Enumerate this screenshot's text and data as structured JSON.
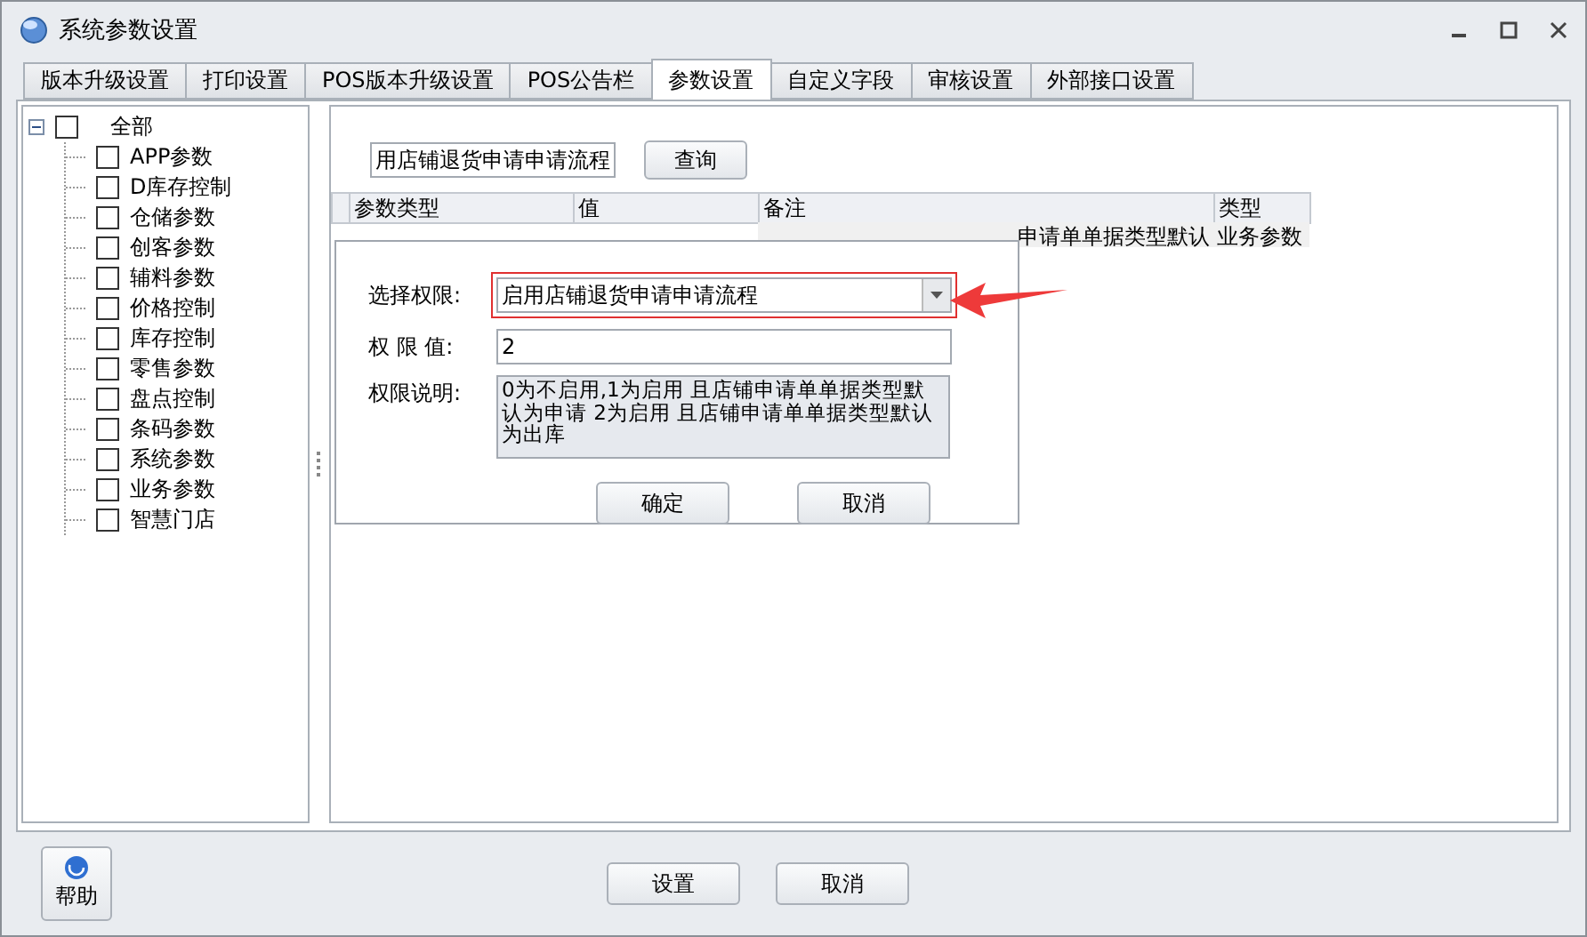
{
  "window": {
    "title": "系统参数设置"
  },
  "tabs": [
    {
      "label": "版本升级设置",
      "selected": false
    },
    {
      "label": "打印设置",
      "selected": false
    },
    {
      "label": "POS版本升级设置",
      "selected": false
    },
    {
      "label": "POS公告栏",
      "selected": false
    },
    {
      "label": "参数设置",
      "selected": true
    },
    {
      "label": "自定义字段",
      "selected": false
    },
    {
      "label": "审核设置",
      "selected": false
    },
    {
      "label": "外部接口设置",
      "selected": false
    }
  ],
  "tree": {
    "label": "全部",
    "checked": false,
    "expanded": true,
    "children": [
      {
        "label": "APP参数",
        "checked": false
      },
      {
        "label": "D库存控制",
        "checked": false
      },
      {
        "label": "仓储参数",
        "checked": false
      },
      {
        "label": "创客参数",
        "checked": false
      },
      {
        "label": "辅料参数",
        "checked": false
      },
      {
        "label": "价格控制",
        "checked": false
      },
      {
        "label": "库存控制",
        "checked": false
      },
      {
        "label": "零售参数",
        "checked": false
      },
      {
        "label": "盘点控制",
        "checked": false
      },
      {
        "label": "条码参数",
        "checked": false
      },
      {
        "label": "系统参数",
        "checked": false
      },
      {
        "label": "业务参数",
        "checked": false
      },
      {
        "label": "智慧门店",
        "checked": false
      }
    ]
  },
  "search": {
    "value": "用店铺退货申请申请流程",
    "button": "查询"
  },
  "table": {
    "columns": [
      "参数类型",
      "值",
      "备注",
      "类型"
    ],
    "rows": [
      [
        "",
        "",
        "申请单单据类型默认",
        "业务参数"
      ]
    ]
  },
  "dialog": {
    "select_label": "选择权限:",
    "select_value": "启用店铺退货申请申请流程",
    "value_label": "权 限 值:",
    "value": "2",
    "desc_label": "权限说明:",
    "description": "0为不启用,1为启用 且店铺申请单单据类型默认为申请 2为启用 且店铺申请单单据类型默认为出库",
    "buttons": [
      "确定",
      "取消"
    ]
  },
  "help_button": "帮助",
  "buttons": [
    "设置",
    "取消"
  ]
}
